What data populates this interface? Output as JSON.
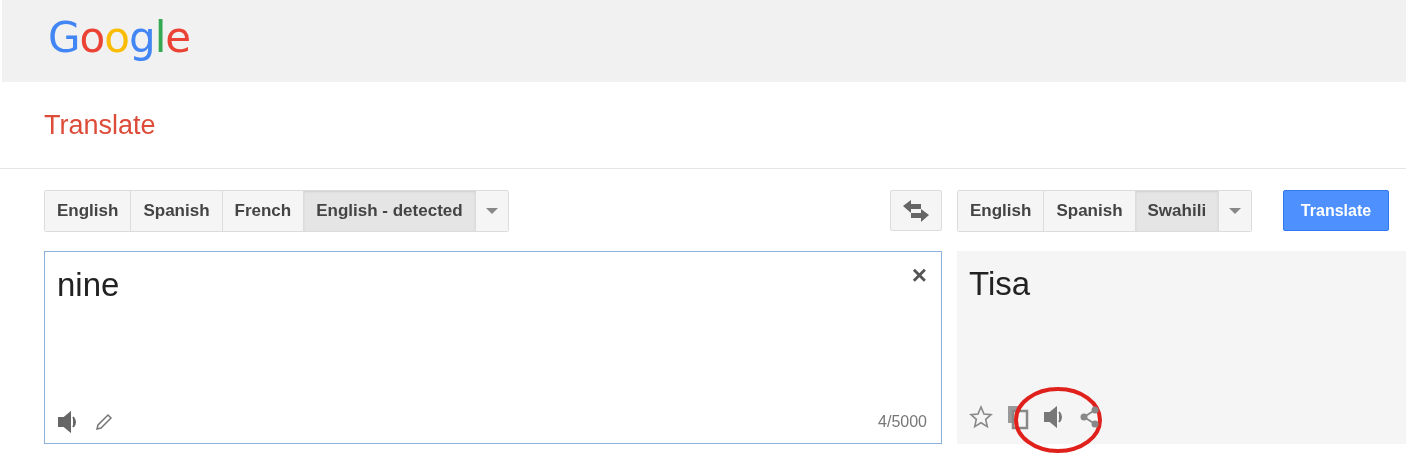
{
  "header": {
    "logo": "Google"
  },
  "title": "Translate",
  "source_languages": [
    {
      "label": "English",
      "selected": false
    },
    {
      "label": "Spanish",
      "selected": false
    },
    {
      "label": "French",
      "selected": false
    },
    {
      "label": "English - detected",
      "selected": true
    }
  ],
  "target_languages": [
    {
      "label": "English",
      "selected": false
    },
    {
      "label": "Spanish",
      "selected": false
    },
    {
      "label": "Swahili",
      "selected": true
    }
  ],
  "translate_button": "Translate",
  "source": {
    "value": "nine",
    "clear": "×",
    "count": "4/5000"
  },
  "output": {
    "text": "Tisa",
    "icons": [
      {
        "kind": "star",
        "circled": false
      },
      {
        "kind": "copy",
        "circled": false
      },
      {
        "kind": "speaker",
        "circled": true
      },
      {
        "kind": "share",
        "circled": false
      }
    ]
  }
}
